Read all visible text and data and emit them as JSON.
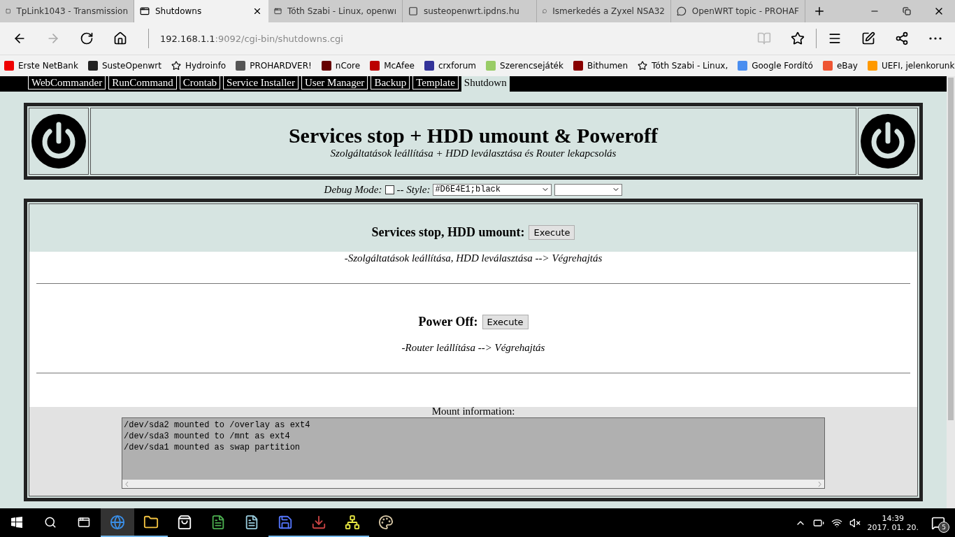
{
  "browser": {
    "tabs": [
      {
        "title": "TpLink1043 - Transmission",
        "selected": false,
        "kind": "logo"
      },
      {
        "title": "Shutdowns",
        "selected": true,
        "kind": "page"
      },
      {
        "title": "Tóth Szabi - Linux, openwı",
        "selected": false,
        "kind": "page"
      },
      {
        "title": "susteopenwrt.ipdns.hu",
        "selected": false,
        "kind": "logo"
      },
      {
        "title": "Ismerkedés a Zyxel NSA32",
        "selected": false,
        "kind": "forum"
      },
      {
        "title": "OpenWRT topic - PROHAF",
        "selected": false,
        "kind": "forum"
      }
    ],
    "address": {
      "host": "192.168.1.1",
      "path": ":9092/cgi-bin/shutdowns.cgi"
    },
    "bookmarks": [
      "Erste NetBank",
      "SusteOpenwrt",
      "Hydroinfo",
      "PROHARDVER!",
      "nCore",
      "McAfee",
      "crxforum",
      "Szerencsejáték",
      "Bithumen",
      "Tóth Szabi - Linux,",
      "Google Fordító",
      "eBay",
      "UEFI, jelenkorunk"
    ]
  },
  "page": {
    "nav": [
      {
        "label": "WebCommander",
        "selected": false
      },
      {
        "label": "RunCommand",
        "selected": false
      },
      {
        "label": "Crontab",
        "selected": false
      },
      {
        "label": "Service Installer",
        "selected": false
      },
      {
        "label": "User Manager",
        "selected": false
      },
      {
        "label": "Backup",
        "selected": false
      },
      {
        "label": "Template",
        "selected": false
      },
      {
        "label": "Shutdown",
        "selected": true
      }
    ],
    "header": {
      "title": "Services stop + HDD umount & Poweroff",
      "subtitle": "Szolgáltatások leállítása + HDD leválasztása és Router lekapcsolás"
    },
    "controls": {
      "debug_label": "Debug Mode:",
      "debug_checked": false,
      "style_label": "-- Style:",
      "style_value": "#D6E4E1;black"
    },
    "actions": [
      {
        "title": "Services stop, HDD umount:",
        "button": "Execute",
        "description": "-Szolgáltatások leállítása, HDD leválasztása --> Végrehajtás"
      },
      {
        "title": "Power Off:",
        "button": "Execute",
        "description": "-Router leállítása --> Végrehajtás"
      }
    ],
    "mount": {
      "label": "Mount information:",
      "lines": [
        "/dev/sda2 mounted to /overlay as ext4",
        "/dev/sda3 mounted to /mnt as ext4",
        "/dev/sda1 mounted as swap partition"
      ]
    }
  },
  "taskbar": {
    "apps": [
      {
        "kind": "edge",
        "running": true,
        "selected": true
      },
      {
        "kind": "folder",
        "running": true,
        "selected": false
      },
      {
        "kind": "store",
        "running": false,
        "selected": false
      },
      {
        "kind": "note",
        "running": false,
        "selected": false
      },
      {
        "kind": "notepad",
        "running": false,
        "selected": false
      },
      {
        "kind": "disk",
        "running": true,
        "selected": false
      },
      {
        "kind": "download",
        "running": true,
        "selected": false
      },
      {
        "kind": "network",
        "running": true,
        "selected": false
      },
      {
        "kind": "paint",
        "running": false,
        "selected": false
      }
    ],
    "time": "14:39",
    "date": "2017. 01. 20.",
    "notifications": "5"
  }
}
